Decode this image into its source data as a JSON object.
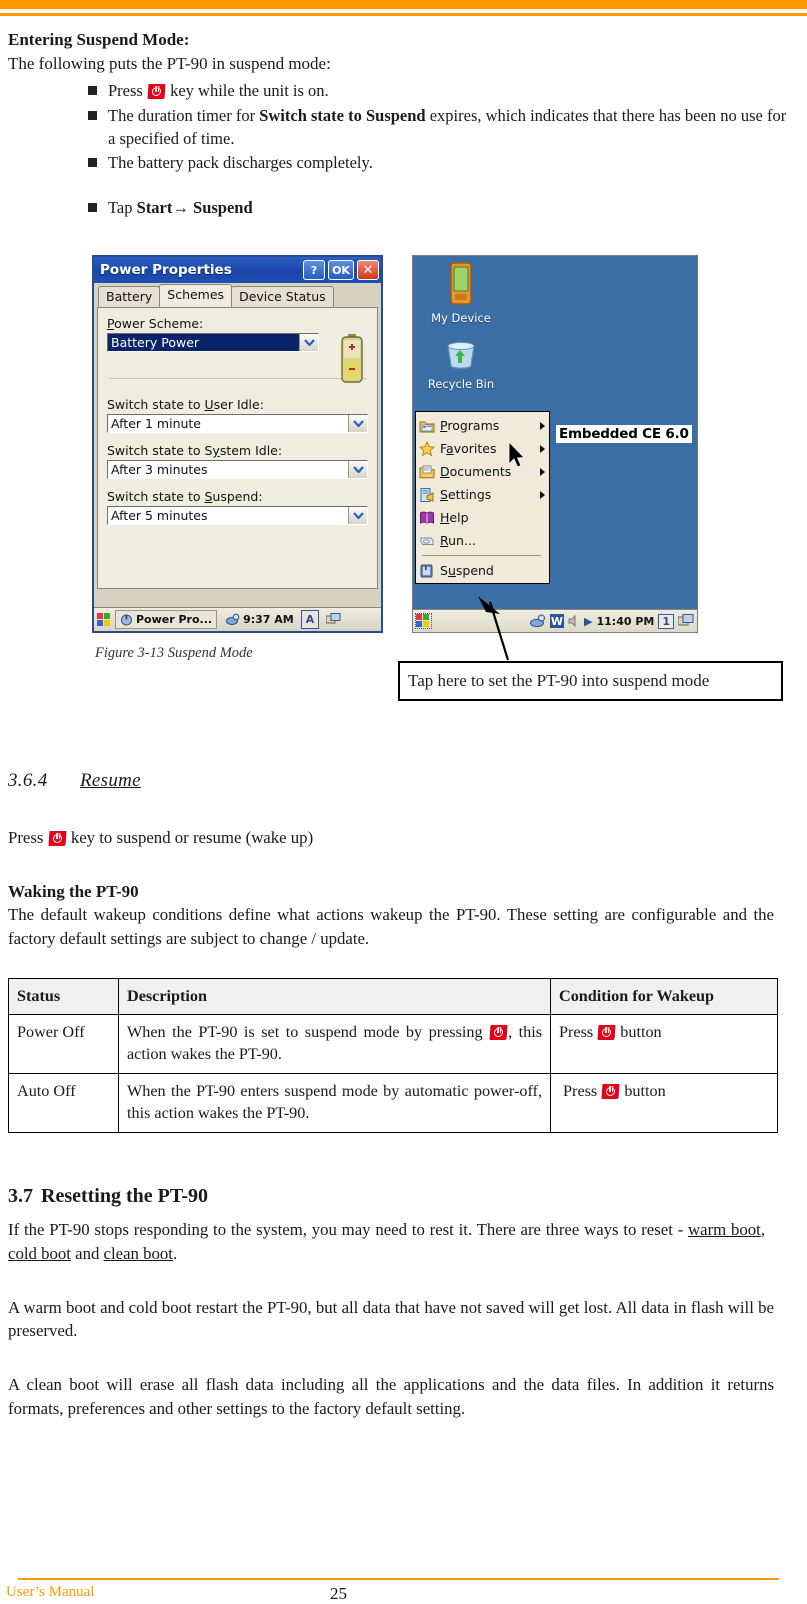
{
  "header": {
    "rule_color": "#FF9900"
  },
  "intro": {
    "heading": "Entering Suspend Mode:",
    "lead": "The following puts the PT-90 in suspend mode:",
    "bullets": [
      {
        "pre": "Press ",
        "icon": "power-key-icon",
        "post": " key while the unit is on."
      },
      {
        "pre": "The duration timer for ",
        "bold": "Switch state to Suspend",
        "post": " expires, which indicates that there has been no use for a specified of time."
      },
      {
        "pre": "The battery pack discharges completely."
      },
      {
        "pre": "Tap ",
        "bold": "Start",
        "arrow": "→",
        "bold2": "Suspend"
      }
    ]
  },
  "figure": {
    "caption": "Figure 3-13 Suspend Mode",
    "callout": "Tap here to set the PT-90 into suspend mode"
  },
  "power_dialog": {
    "title": "Power Properties",
    "title_buttons": [
      {
        "name": "help-button",
        "label": "?"
      },
      {
        "name": "ok-button",
        "label": "OK"
      },
      {
        "name": "close-button",
        "label": "✕"
      }
    ],
    "tabs": [
      {
        "label": "Battery",
        "active": false
      },
      {
        "label": "Schemes",
        "active": true
      },
      {
        "label": "Device Status",
        "active": false
      }
    ],
    "fields": [
      {
        "label": "Power Scheme:",
        "value": "Battery Power",
        "selected": true
      },
      {
        "label": "Switch state to User Idle:",
        "value": "After 1 minute",
        "selected": false
      },
      {
        "label": "Switch state to System Idle:",
        "value": "After 3 minutes",
        "selected": false
      },
      {
        "label": "Switch state to Suspend:",
        "value": "After 5 minutes",
        "selected": false
      }
    ],
    "taskbar": {
      "app_label": "Power Pro...",
      "clock": "9:37 AM",
      "sip_label": "A"
    }
  },
  "wince_desktop": {
    "desktop_icons": [
      {
        "label": "My Device",
        "icon": "device-icon"
      },
      {
        "label": "Recycle Bin",
        "icon": "recycle-bin-icon"
      }
    ],
    "embedded_label": "Embedded CE 6.0",
    "start_menu": [
      {
        "label": "Programs",
        "accel": "P",
        "submenu": true,
        "icon": "programs-icon"
      },
      {
        "label": "Favorites",
        "accel": "a",
        "submenu": true,
        "icon": "favorites-star-icon"
      },
      {
        "label": "Documents",
        "accel": "D",
        "submenu": true,
        "icon": "documents-icon"
      },
      {
        "label": "Settings",
        "accel": "S",
        "submenu": true,
        "icon": "settings-icon"
      },
      {
        "label": "Help",
        "accel": "H",
        "submenu": false,
        "icon": "help-book-icon"
      },
      {
        "label": "Run...",
        "accel": "R",
        "submenu": false,
        "icon": "run-icon"
      },
      {
        "label": "Suspend",
        "accel": "u",
        "submenu": false,
        "icon": "suspend-icon"
      }
    ],
    "taskbar": {
      "clock": "11:40 PM",
      "badge": "1"
    }
  },
  "resume": {
    "number": "3.6.4",
    "title": "Resume",
    "press_pre": "Press ",
    "press_post": " key to suspend or resume (wake up)",
    "waking_heading": "Waking the PT-90",
    "waking_body": "The default wakeup conditions define what actions wakeup the PT-90. These setting are configurable and the factory default settings are subject to change / update."
  },
  "wakeup_table": {
    "headers": [
      "Status",
      "Description",
      "Condition for Wakeup"
    ],
    "rows": [
      {
        "status": "Power Off",
        "desc_pre": "When the PT-90 is set to suspend mode by pressing ",
        "desc_post": ", this action wakes the PT-90.",
        "cond_pre": "Press ",
        "cond_post": " button"
      },
      {
        "status": "Auto Off",
        "desc_pre": "When the PT-90 enters suspend mode by automatic power-off, this action wakes the PT-90.",
        "desc_post": "",
        "cond_pre": "Press ",
        "cond_post": " button"
      }
    ]
  },
  "resetting": {
    "number": "3.7",
    "title": "Resetting the PT-90",
    "p1_a": "If the PT-90 stops responding to the system, you may need to rest it. There are three ways to reset - ",
    "p1_link1": "warm boot",
    "p1_b": ",   ",
    "p1_link2": "cold boot",
    "p1_c": " and ",
    "p1_link3": "clean boot",
    "p1_d": ".",
    "p2": "A warm boot and cold boot restart the PT-90, but all data that have not saved will get lost. All data in flash will be preserved.",
    "p3": "A clean boot will erase all flash data including all the applications and the data files. In addition it returns formats, preferences and other settings to the factory default setting."
  },
  "footer": {
    "left": "User’s Manual",
    "page": "25"
  }
}
